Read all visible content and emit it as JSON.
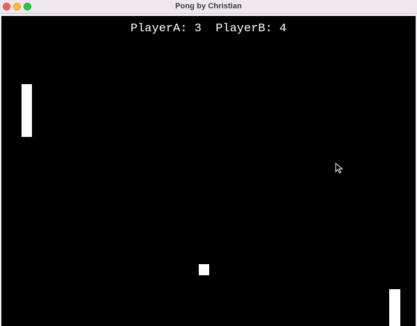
{
  "window": {
    "title": "Pong by Christian",
    "controls": {
      "close_color": "#ff5f57",
      "minimize_color": "#febc2e",
      "maximize_color": "#28c840"
    }
  },
  "game": {
    "background_color": "#000000",
    "foreground_color": "#ffffff",
    "scoreboard": "PlayerA: 3  PlayerB: 4",
    "player_a_score": 3,
    "player_b_score": 4
  },
  "pointer": {
    "icon": "arrow-cursor-icon"
  }
}
